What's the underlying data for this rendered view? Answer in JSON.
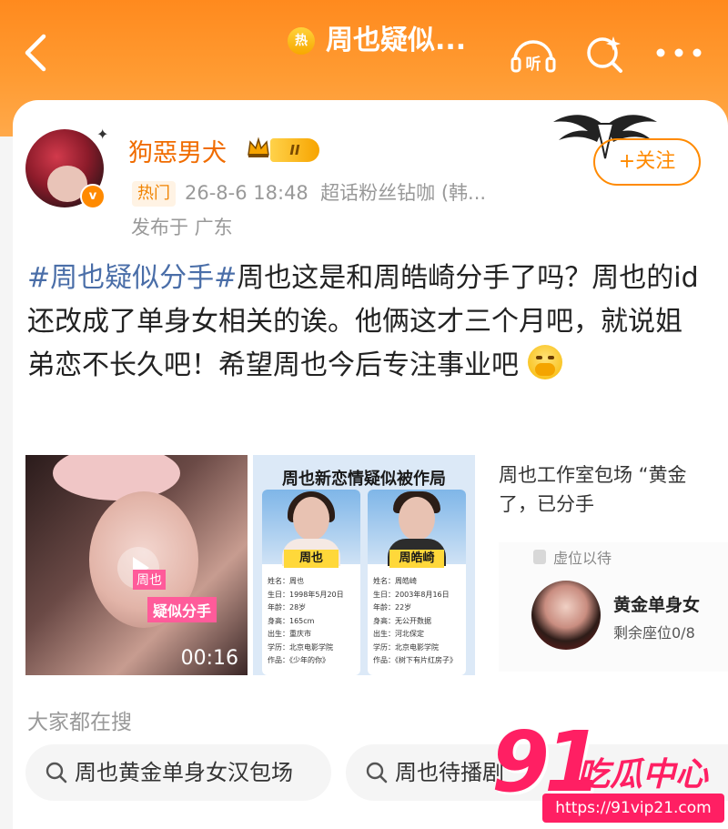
{
  "header": {
    "hot_badge": "热",
    "title": "周也疑似...",
    "icons": [
      "back-icon",
      "listen-icon",
      "search-spark-icon",
      "more-icon"
    ],
    "listen_label": "听"
  },
  "post": {
    "author": {
      "name": "狗惡男犬",
      "level_badge": "II",
      "verified_mark": "v"
    },
    "meta": {
      "tag": "热门",
      "datetime": "26-8-6 18:48",
      "source": "超话粉丝钻咖 (韩..."
    },
    "posted_from": "发布于 广东",
    "follow_label": "+关注",
    "text": {
      "hashtag": "#周也疑似分手#",
      "body": "周也这是和周皓崎分手了吗？周也的id还改成了单身女相关的诶。他俩这才三个月吧，就说姐弟恋不长久吧！希望周也今后专注事业吧"
    },
    "media": {
      "video": {
        "name_tag": "周也",
        "caption": "疑似分手",
        "duration": "00:16"
      },
      "infographic": {
        "title": "周也新恋情疑似被作局",
        "profiles": [
          {
            "name": "周也",
            "rows": [
              "姓名：周也",
              "生日：1998年5月20日",
              "年龄：28岁",
              "身高：165cm",
              "出生：重庆市",
              "学历：北京电影学院",
              "作品：《少年的你》"
            ]
          },
          {
            "name": "周皓崎",
            "rows": [
              "姓名：周皓崎",
              "生日：2003年8月16日",
              "年龄：22岁",
              "身高：无公开数据",
              "出生：河北保定",
              "学历：北京电影学院",
              "作品：《树下有片红房子》"
            ]
          }
        ]
      },
      "news": {
        "text": "周也工作室包场 “黄金 了，已分手",
        "seat_label": "虚位以待",
        "seat_title": "黄金单身女",
        "seat_remaining": "剩余座位0/8"
      }
    }
  },
  "trending": {
    "label": "大家都在搜",
    "searches": [
      "周也黄金单身女汉包场",
      "周也待播剧"
    ]
  },
  "watermark": {
    "number": "91",
    "name": "吃瓜中心",
    "url": "https://91vip21.com"
  },
  "colors": {
    "header_orange": "#ff8a1e",
    "username_orange": "#f06c00",
    "hashtag_blue": "#4a6ea8",
    "watermark_pink": "#ff1f63"
  }
}
